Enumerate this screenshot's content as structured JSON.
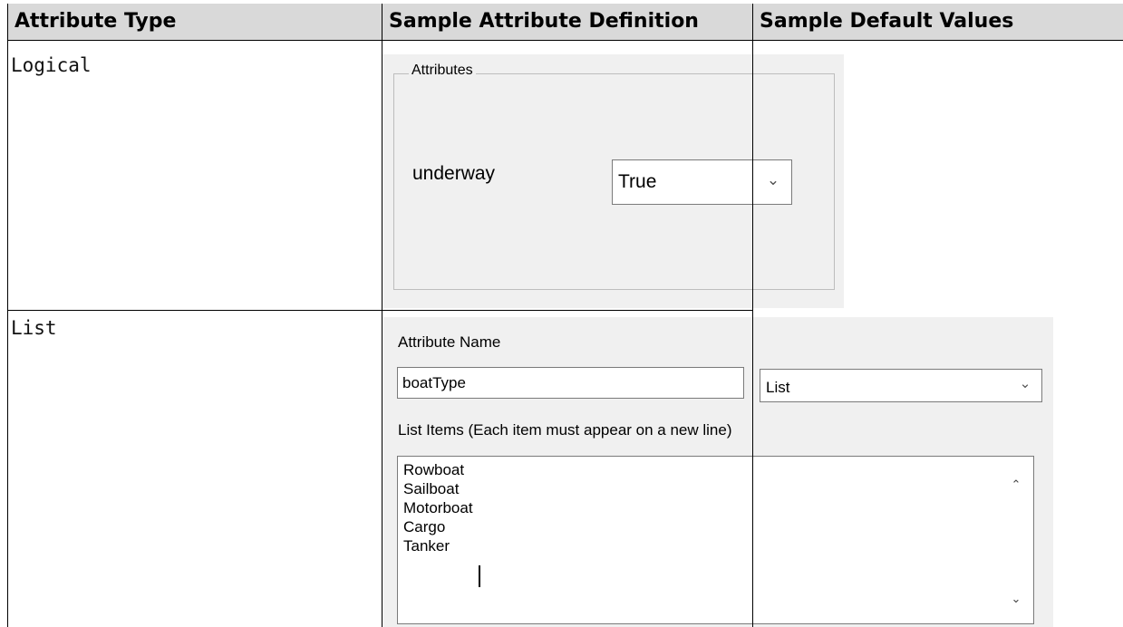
{
  "table": {
    "headers": [
      "Attribute Type",
      "Sample Attribute Definition",
      "Sample Default Values"
    ],
    "rows": [
      {
        "type": "Logical"
      },
      {
        "type": "List"
      }
    ]
  },
  "logical_dialog": {
    "group_title": "Attributes",
    "attribute_label": "underway",
    "value": "True"
  },
  "list_dialog": {
    "name_label": "Attribute Name",
    "name_value": "boatType",
    "type_value": "List",
    "items_label": "List Items (Each item must appear on a new line)",
    "items": [
      "Rowboat",
      "Sailboat",
      "Motorboat",
      "Cargo",
      "Tanker"
    ]
  },
  "icons": {
    "combo_arrow": "chevron-down-icon",
    "scroll_up": "chevron-up-icon",
    "scroll_down": "chevron-down-icon"
  },
  "colors": {
    "header_bg": "#d9d9d9",
    "dialog_bg": "#f0f0f0",
    "grid_line": "#000000"
  }
}
